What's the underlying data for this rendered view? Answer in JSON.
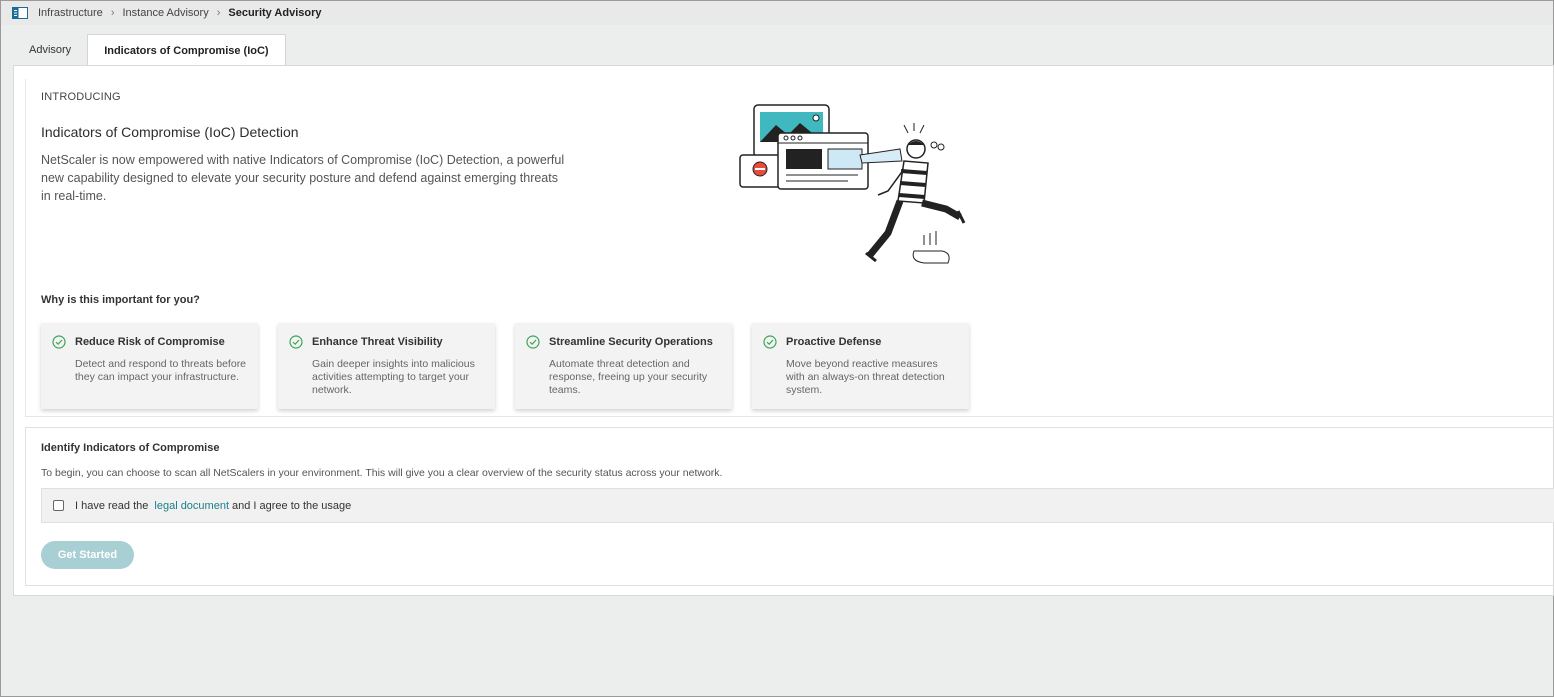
{
  "breadcrumb": {
    "items": [
      "Infrastructure",
      "Instance Advisory",
      "Security Advisory"
    ]
  },
  "tabs": [
    {
      "label": "Advisory",
      "active": false
    },
    {
      "label": "Indicators of Compromise (IoC)",
      "active": true
    }
  ],
  "intro": {
    "overline": "INTRODUCING",
    "title": "Indicators of Compromise (IoC) Detection",
    "description": "NetScaler is now empowered with native Indicators of Compromise (IoC) Detection, a powerful new capability designed to elevate your security posture and defend against emerging threats in real-time."
  },
  "why": {
    "heading": "Why is this important for you?",
    "cards": [
      {
        "title": "Reduce Risk of Compromise",
        "description": "Detect and respond to threats before they can impact your infrastructure."
      },
      {
        "title": "Enhance Threat Visibility",
        "description": "Gain deeper insights into malicious activities attempting to target your network."
      },
      {
        "title": "Streamline Security Operations",
        "description": "Automate threat detection and response, freeing up your security teams."
      },
      {
        "title": "Proactive Defense",
        "description": "Move beyond reactive measures with an always-on threat detection system."
      }
    ]
  },
  "identify": {
    "title": "Identify Indicators of Compromise",
    "description": "To begin, you can choose to scan all NetScalers in your environment. This will give you a clear overview of the security status across your network.",
    "agree_prefix": "I have read the",
    "agree_link": "legal document",
    "agree_suffix": "and I agree to the usage",
    "button_label": "Get Started"
  },
  "colors": {
    "accent": "#1b7f8a",
    "check": "#3aa655",
    "button_disabled": "#a7cfd4"
  }
}
